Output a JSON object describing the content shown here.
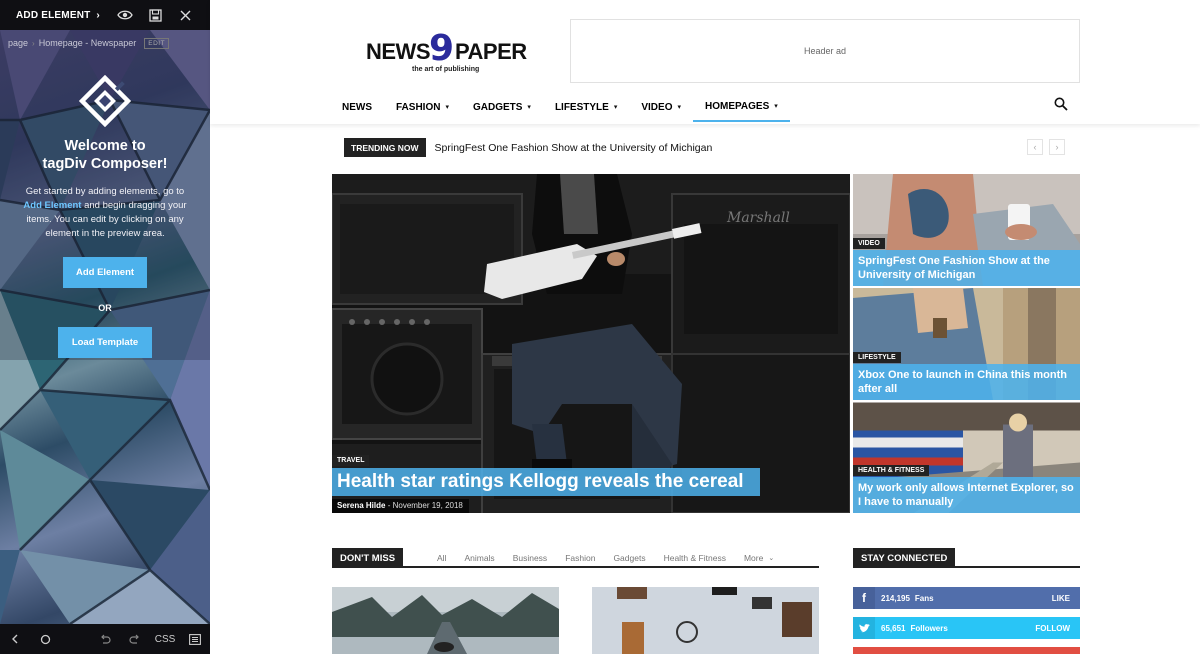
{
  "composer": {
    "add_element": "ADD ELEMENT",
    "breadcrumb": [
      "page",
      "Homepage - Newspaper"
    ],
    "edit_badge": "EDIT",
    "welcome_line1": "Welcome to",
    "welcome_line2": "tagDiv Composer!",
    "desc_part1": "Get started by adding elements, go to",
    "desc_link": "Add Element",
    "desc_part2": "and begin dragging your items. You can edit by clicking on any element in the preview area.",
    "add_button": "Add Element",
    "or": "OR",
    "template_button": "Load Template",
    "css_label": "CSS",
    "accent": "#4db2ec"
  },
  "site": {
    "brand_left": "NEWS",
    "brand_nine": "9",
    "brand_right": "PAPER",
    "tagline": "the art of publishing",
    "header_ad": "Header ad",
    "nav": [
      {
        "label": "NEWS",
        "dropdown": false
      },
      {
        "label": "FASHION",
        "dropdown": true
      },
      {
        "label": "GADGETS",
        "dropdown": true
      },
      {
        "label": "LIFESTYLE",
        "dropdown": true
      },
      {
        "label": "VIDEO",
        "dropdown": true
      },
      {
        "label": "HOMEPAGES",
        "dropdown": true,
        "active": true
      }
    ],
    "trending_tag": "TRENDING NOW",
    "trending_headline": "SpringFest One Fashion Show at the University of Michigan",
    "big": {
      "category": "TRAVEL",
      "title": "Health star ratings Kellogg reveals the cereal",
      "author": "Serena Hilde",
      "date": "November 19, 2018"
    },
    "small": [
      {
        "category": "VIDEO",
        "title": "SpringFest One Fashion Show at the University of Michigan"
      },
      {
        "category": "LIFESTYLE",
        "title": "Xbox One to launch in China this month after all"
      },
      {
        "category": "HEALTH & FITNESS",
        "title": "My work only allows Internet Explorer, so I have to manually"
      }
    ],
    "dont_miss": {
      "title": "DON'T MISS",
      "filters": [
        "All",
        "Animals",
        "Business",
        "Fashion",
        "Gadgets",
        "Health & Fitness"
      ],
      "more": "More"
    },
    "stay_connected": "STAY CONNECTED",
    "social": [
      {
        "network": "facebook",
        "icon": "f",
        "count": "214,195",
        "unit": "Fans",
        "action": "LIKE",
        "color": "#516eab"
      },
      {
        "network": "twitter",
        "icon": "t",
        "count": "65,651",
        "unit": "Followers",
        "action": "FOLLOW",
        "color": "#29c5f6"
      }
    ]
  }
}
